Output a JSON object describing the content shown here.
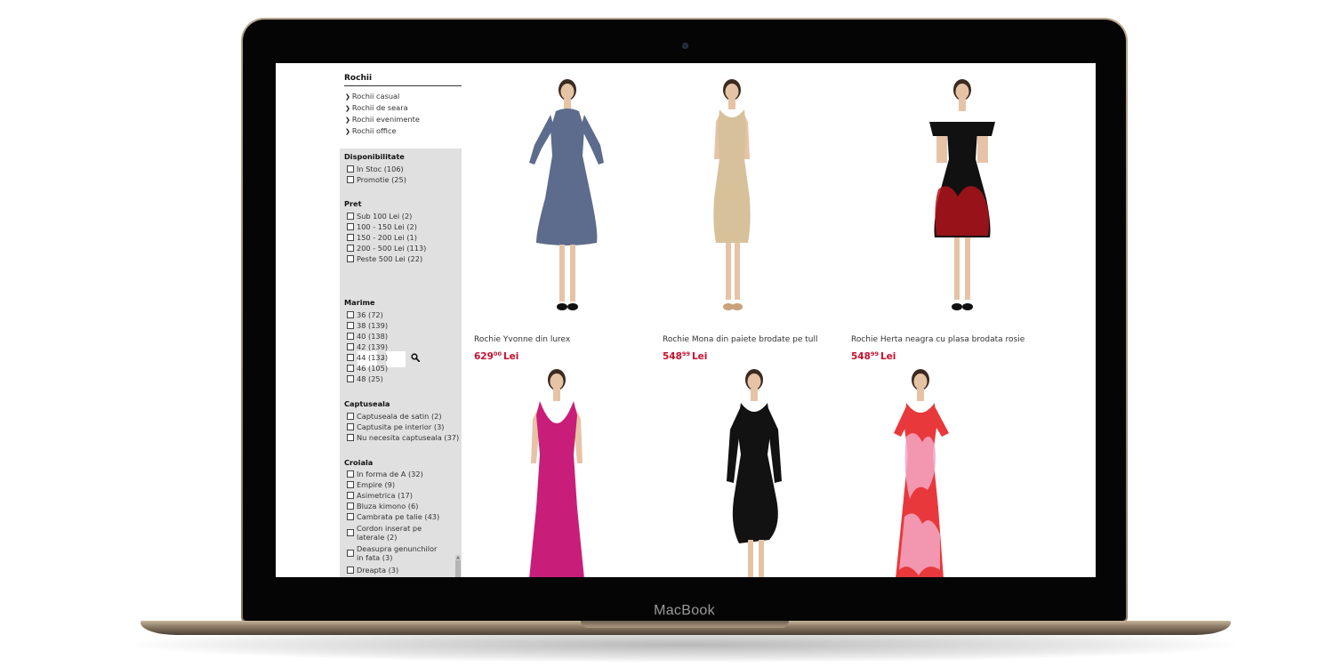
{
  "device": {
    "label": "MacBook"
  },
  "category": {
    "title": "Rochii",
    "items": [
      "Rochii casual",
      "Rochii de seara",
      "Rochii evenimente",
      "Rochii office"
    ]
  },
  "filters": {
    "availability": {
      "title": "Disponibilitate",
      "options": [
        "In Stoc (106)",
        "Promotie (25)"
      ]
    },
    "price": {
      "title": "Pret",
      "options": [
        "Sub 100 Lei (2)",
        "100 - 150 Lei (2)",
        "150 - 200 Lei (1)",
        "200 - 500 Lei (113)",
        "Peste 500 Lei (22)"
      ],
      "range_separator": "-"
    },
    "size": {
      "title": "Marime",
      "options": [
        "36 (72)",
        "38 (139)",
        "40 (138)",
        "42 (139)",
        "44 (133)",
        "46 (105)",
        "48 (25)"
      ]
    },
    "lining": {
      "title": "Captuseala",
      "options": [
        "Captuseala de satin (2)",
        "Captusita pe interior (3)",
        "Nu necesita captuseala (37)"
      ]
    },
    "cut": {
      "title": "Croiala",
      "options": [
        "In forma de A (32)",
        "Empire (9)",
        "Asimetrica (17)",
        "Bluza kimono (6)",
        "Cambrata pe talie (43)",
        "Cordon inserat pe laterale (2)",
        "Deasupra genunchilor in fata (3)",
        "Dreapta (3)"
      ]
    }
  },
  "products": [
    {
      "name": "Rochie Yvonne din lurex",
      "price_int": "629",
      "price_dec": "00",
      "currency": "Lei",
      "dress_color": "#5d6b8c"
    },
    {
      "name": "Rochie Mona din paiete brodate pe tull",
      "price_int": "548",
      "price_dec": "99",
      "currency": "Lei",
      "dress_color": "#d6c19a"
    },
    {
      "name": "Rochie Herta neagra cu plasa brodata rosie",
      "price_int": "548",
      "price_dec": "99",
      "currency": "Lei",
      "dress_color": "#111111"
    },
    {
      "name": "",
      "dress_color": "#c81e79"
    },
    {
      "name": "",
      "dress_color": "#121212"
    },
    {
      "name": "",
      "dress_color": "#e8383b"
    }
  ],
  "colors": {
    "price": "#c8102e",
    "filter_panel": "#e0e0e0"
  }
}
